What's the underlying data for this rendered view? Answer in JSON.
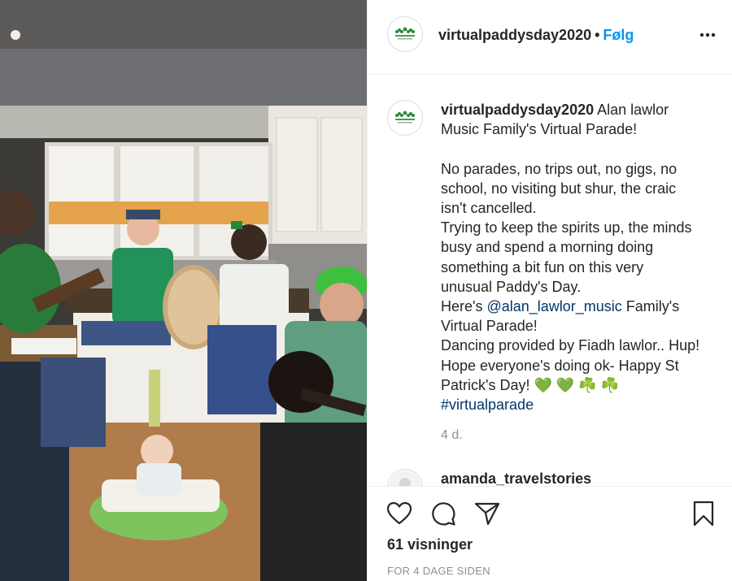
{
  "post": {
    "username": "virtualpaddysday2020",
    "separator": "•",
    "follow_label": "Følg",
    "more_icon": "more-options-icon"
  },
  "caption": {
    "username": "virtualpaddysday2020",
    "line1_rest": " Alan lawlor",
    "line2": "Music Family's Virtual Parade!",
    "line3": "No parades, no trips out, no gigs, no",
    "line4": "school, no visiting but shur, the craic",
    "line5": "isn't cancelled.",
    "line6": "Trying to keep the spirits up, the minds",
    "line7": "busy and spend a morning doing",
    "line8": "something a bit fun on this very",
    "line9": "unusual Paddy's Day.",
    "line10_pre": "Here's ",
    "mention": "@alan_lawlor_music",
    "line10_post": " Family's",
    "line11": "Virtual Parade!",
    "line12": "Dancing provided by Fiadh lawlor.. Hup!",
    "line13": "Hope everyone's doing ok- Happy St",
    "line14": "Patrick's Day! 💚 💚 ☘️ ☘️",
    "hashtag": "#virtualparade",
    "timestamp": "4 d."
  },
  "comments": [
    {
      "username": "amanda_travelstories"
    }
  ],
  "actions": {
    "like_icon": "heart-icon",
    "comment_icon": "comment-icon",
    "share_icon": "share-icon",
    "save_icon": "bookmark-icon",
    "views": "61 visninger",
    "posted_ago": "FOR 4 DAGE SIDEN"
  },
  "colors": {
    "accent_blue": "#0095f6",
    "link": "#00376b",
    "muted": "#8e8e8e",
    "border": "#efefef"
  }
}
